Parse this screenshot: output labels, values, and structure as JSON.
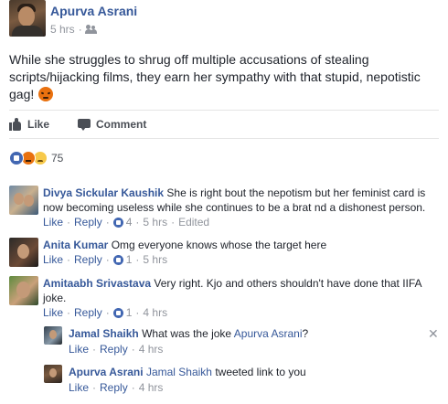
{
  "post": {
    "author": "Apurva Asrani",
    "time": "5 hrs",
    "separator": "·",
    "text": "While she struggles to shrug off multiple accusations of stealing scripts/hijacking films, they earn her sympathy with that stupid, nepotistic gag!",
    "privacy_icon": "friends-icon"
  },
  "actions": {
    "like_label": "Like",
    "comment_label": "Comment"
  },
  "reactions": {
    "types": [
      "like",
      "angry",
      "sad"
    ],
    "count": "75"
  },
  "comments": [
    {
      "name": "Divya Sickular Kaushik",
      "text": "She is right bout the nepotism but her feminist card is now becoming useless while she continues to be a brat nd a dishonest person.",
      "like": "Like",
      "reply": "Reply",
      "likes": "4",
      "time": "5 hrs",
      "edited": "Edited"
    },
    {
      "name": "Anita Kumar",
      "text": "Omg everyone knows whose the target here",
      "like": "Like",
      "reply": "Reply",
      "likes": "1",
      "time": "5 hrs"
    },
    {
      "name": "Amitaabh Srivastava",
      "text": "Very right. Kjo and others shouldn't have done that IIFA joke.",
      "like": "Like",
      "reply": "Reply",
      "likes": "1",
      "time": "4 hrs"
    }
  ],
  "replies": [
    {
      "name": "Jamal Shaikh",
      "text_pre": "What was the joke ",
      "mention": "Apurva Asrani",
      "text_post": "?",
      "like": "Like",
      "reply": "Reply",
      "time": "4 hrs"
    },
    {
      "name": "Apurva Asrani",
      "mention": "Jamal Shaikh",
      "text_post": " tweeted link to you",
      "like": "Like",
      "reply": "Reply",
      "time": "4 hrs"
    }
  ],
  "colors": {
    "link": "#365899",
    "meta": "#90949c",
    "text": "#1d2129",
    "like_blue": "#4267b2",
    "angry_orange": "#e9710f"
  }
}
